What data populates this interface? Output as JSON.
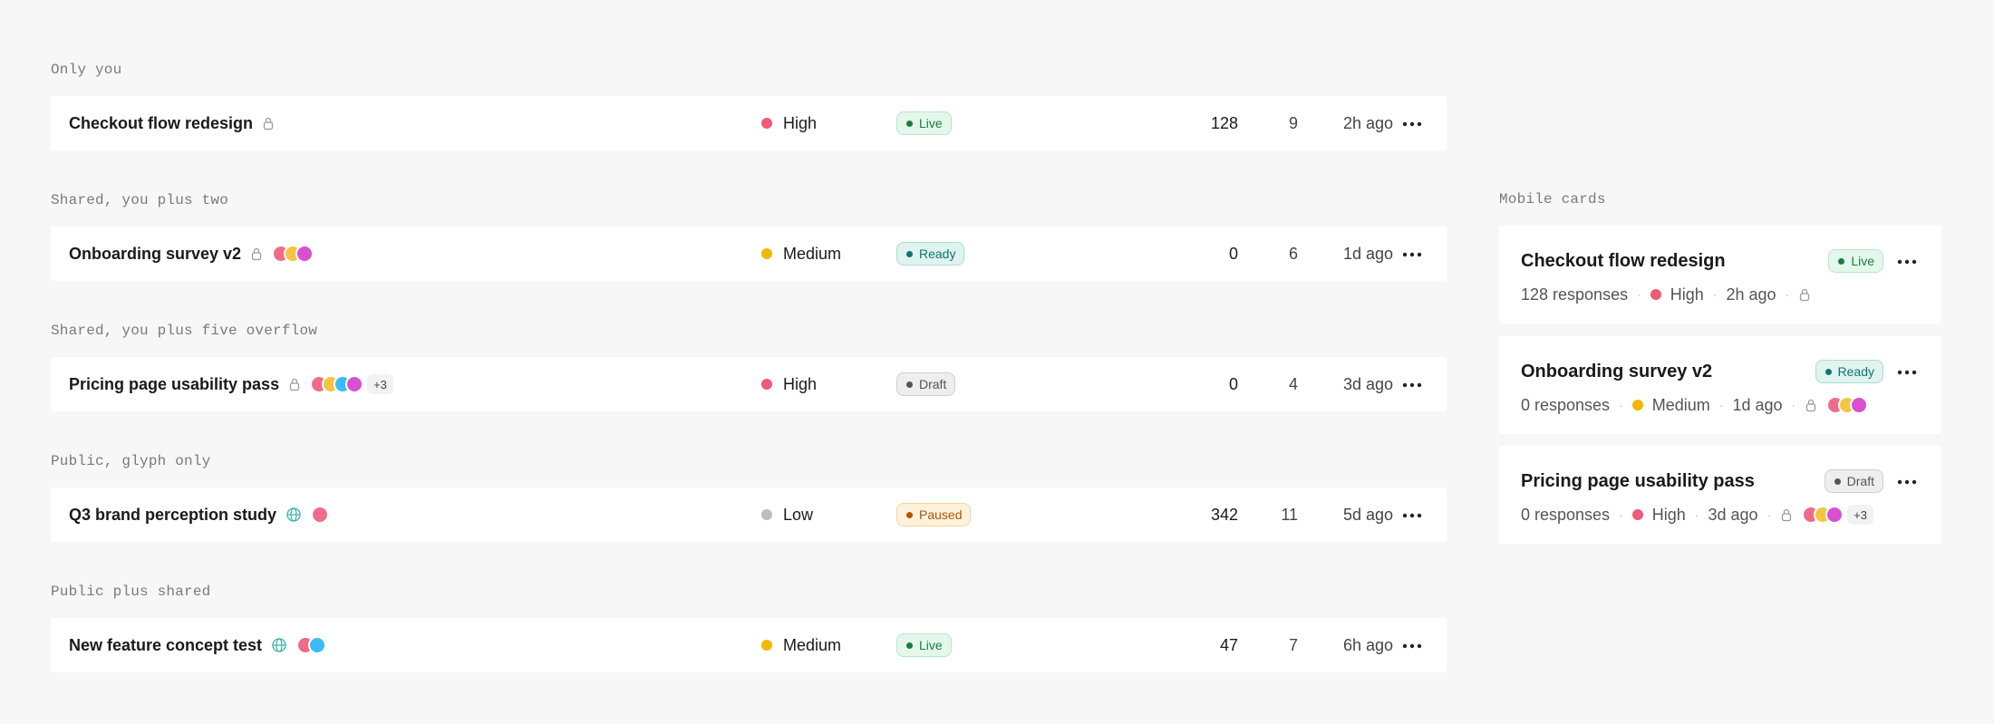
{
  "sections": [
    {
      "label": "Only you"
    },
    {
      "label": "Shared, you plus two"
    },
    {
      "label": "Shared, you plus five overflow"
    },
    {
      "label": "Public, glyph only"
    },
    {
      "label": "Public plus shared"
    }
  ],
  "rows": [
    {
      "name": "Checkout flow redesign",
      "visibility": "lock-icon",
      "avatars": [],
      "overflow": "",
      "priority": "High",
      "priority_color": "#ef5a76",
      "status": "Live",
      "responses": "128",
      "questions": "9",
      "updated": "2h ago"
    },
    {
      "name": "Onboarding survey v2",
      "visibility": "lock-icon",
      "avatars": [
        "#f06b8a",
        "#f5c542",
        "#d94fd1"
      ],
      "overflow": "",
      "priority": "Medium",
      "priority_color": "#f2b705",
      "status": "Ready",
      "responses": "0",
      "questions": "6",
      "updated": "1d ago"
    },
    {
      "name": "Pricing page usability pass",
      "visibility": "lock-icon",
      "avatars": [
        "#f06b8a",
        "#f5c542",
        "#38bdf8",
        "#d94fd1"
      ],
      "overflow": "+3",
      "priority": "High",
      "priority_color": "#ef5a76",
      "status": "Draft",
      "responses": "0",
      "questions": "4",
      "updated": "3d ago"
    },
    {
      "name": "Q3 brand perception study",
      "visibility": "globe-icon",
      "avatars": [
        "#f06b8a"
      ],
      "overflow": "",
      "priority": "Low",
      "priority_color": "#bdbdbd",
      "status": "Paused",
      "responses": "342",
      "questions": "11",
      "updated": "5d ago"
    },
    {
      "name": "New feature concept test",
      "visibility": "globe-icon",
      "avatars": [
        "#f06b8a",
        "#38bdf8"
      ],
      "overflow": "",
      "priority": "Medium",
      "priority_color": "#f2b705",
      "status": "Live",
      "responses": "47",
      "questions": "7",
      "updated": "6h ago"
    }
  ],
  "mobile": {
    "label": "Mobile cards",
    "cards": [
      {
        "title": "Checkout flow redesign",
        "status": "Live",
        "responses": "128 responses",
        "priority": "High",
        "priority_color": "#ef5a76",
        "updated": "2h ago",
        "avatars": [],
        "overflow": ""
      },
      {
        "title": "Onboarding survey v2",
        "status": "Ready",
        "responses": "0 responses",
        "priority": "Medium",
        "priority_color": "#f2b705",
        "updated": "1d ago",
        "avatars": [
          "#f06b8a",
          "#f5c542",
          "#d94fd1"
        ],
        "overflow": ""
      },
      {
        "title": "Pricing page usability pass",
        "status": "Draft",
        "responses": "0 responses",
        "priority": "High",
        "priority_color": "#ef5a76",
        "updated": "3d ago",
        "avatars": [
          "#f06b8a",
          "#f5c542",
          "#d94fd1"
        ],
        "overflow": "+3"
      }
    ]
  },
  "icons": {
    "menu": "more-horizontal-icon"
  }
}
